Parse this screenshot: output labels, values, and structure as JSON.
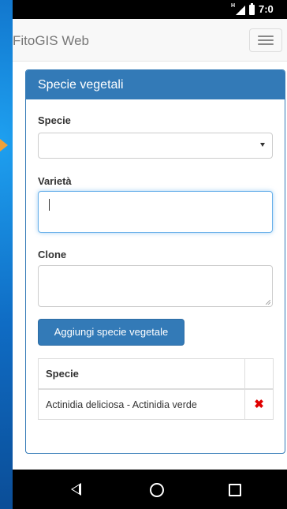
{
  "status_bar": {
    "network_type": "H",
    "time": "7:0"
  },
  "navbar": {
    "brand": "FitoGIS Web",
    "menu_icon": "hamburger-menu-icon"
  },
  "panel": {
    "title": "Specie vegetali",
    "species_field": {
      "label": "Specie",
      "value": ""
    },
    "variety_field": {
      "label": "Varietà",
      "value": "",
      "focused": true
    },
    "clone_field": {
      "label": "Clone",
      "value": ""
    },
    "add_button_label": "Aggiungi specie vegetale",
    "table": {
      "columns": [
        "Specie",
        ""
      ],
      "rows": [
        {
          "species": "Actinidia deliciosa - Actinidia verde",
          "action_icon": "delete-x-icon"
        }
      ]
    }
  },
  "colors": {
    "primary": "#337ab7",
    "delete": "#e00000",
    "navbar_bg": "#f8f8f8"
  },
  "android_nav": {
    "back_icon": "back-triangle-icon",
    "home_icon": "home-circle-icon",
    "recents_icon": "recents-square-icon"
  }
}
